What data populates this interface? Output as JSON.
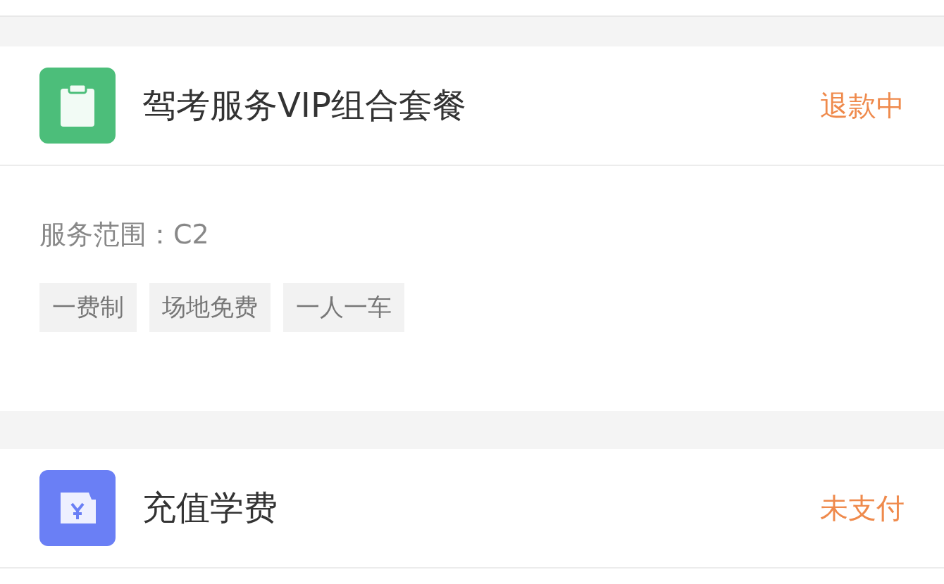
{
  "orders": [
    {
      "kind": "clipboard",
      "color": "#4cbe7a",
      "title": "驾考服务VIP组合套餐",
      "status": "退款中",
      "scope": "服务范围：C2",
      "tags": [
        "一费制",
        "场地免费",
        "一人一车"
      ]
    },
    {
      "kind": "wallet",
      "color": "#6a7ff5",
      "title": "充值学费",
      "status": "未支付"
    }
  ]
}
